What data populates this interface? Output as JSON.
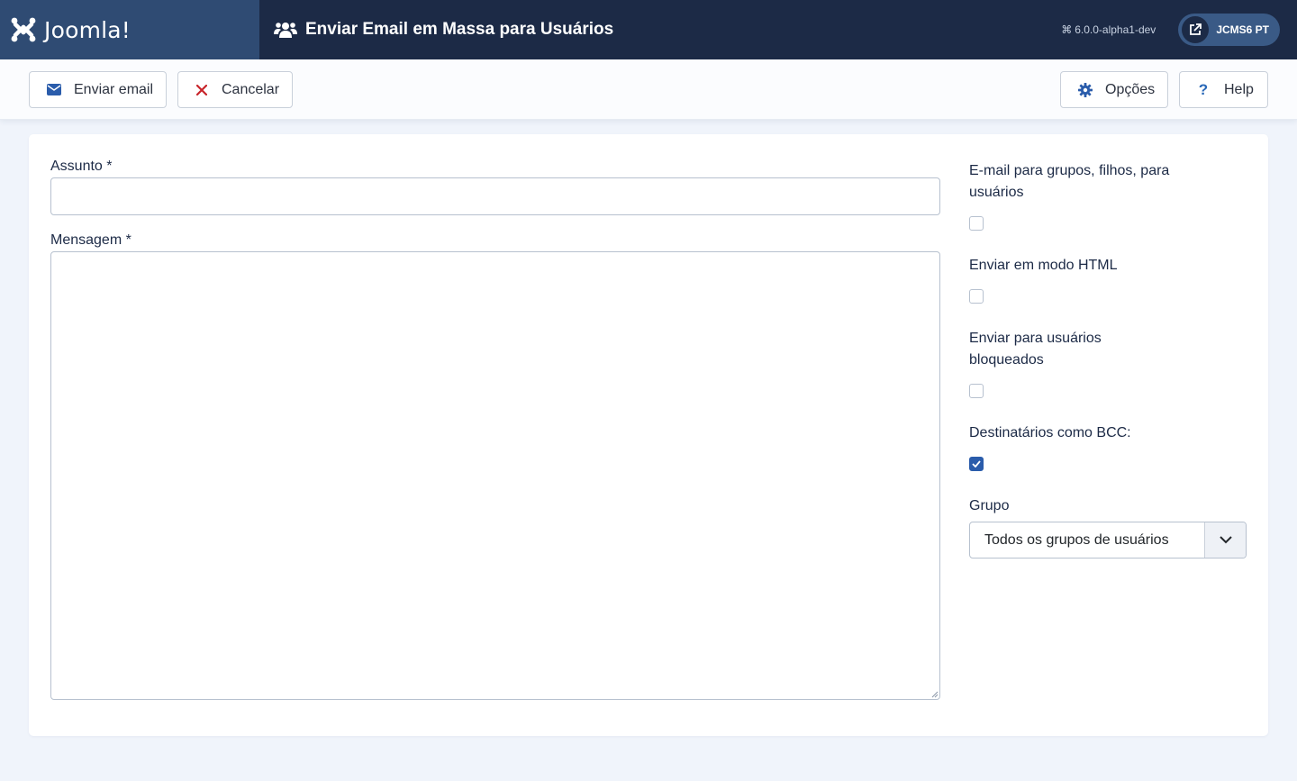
{
  "header": {
    "logo_text": "Joomla!",
    "page_title": "Enviar Email em Massa para Usuários",
    "version": "6.0.0-alpha1-dev",
    "site_button_label": "JCMS6 PT"
  },
  "toolbar": {
    "send_label": "Enviar email",
    "cancel_label": "Cancelar",
    "options_label": "Opções",
    "help_label": "Help"
  },
  "form": {
    "subject_label": "Assunto *",
    "subject_value": "",
    "message_label": "Mensagem *",
    "message_value": ""
  },
  "options": {
    "groups_label": "E-mail para grupos, filhos, para usuários",
    "groups_checked": false,
    "html_label": "Enviar em modo HTML",
    "html_checked": false,
    "blocked_label": "Enviar para usuários bloqueados",
    "blocked_checked": false,
    "bcc_label": "Destinatários como BCC:",
    "bcc_checked": true,
    "group_label": "Grupo",
    "group_selected": "Todos os grupos de usuários"
  },
  "colors": {
    "header_bg": "#1c2a46",
    "logo_bg": "#2f4b73",
    "accent": "#2a5cab",
    "cancel_red": "#c8242a"
  },
  "icons": {
    "logo": "joomla-logo-icon",
    "title": "users-icon",
    "version": "joomla-mini-icon",
    "site": "external-link-icon",
    "send": "envelope-icon",
    "cancel": "close-icon",
    "options": "gear-icon",
    "help": "question-icon",
    "select": "chevron-down-icon"
  }
}
